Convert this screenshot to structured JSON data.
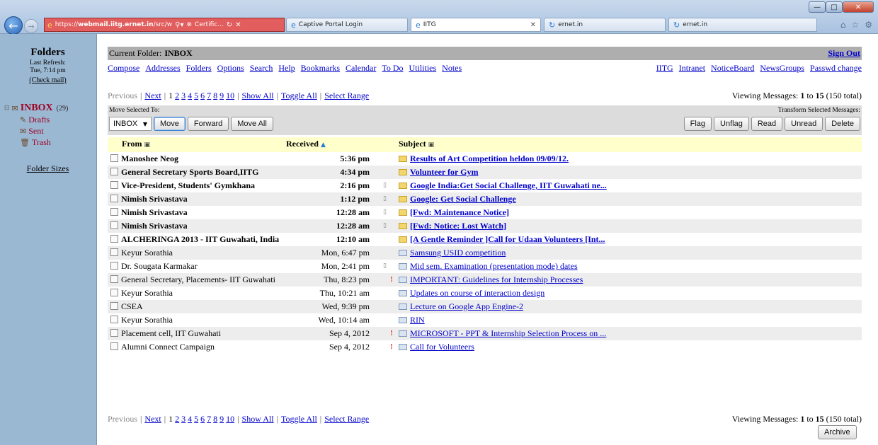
{
  "browser": {
    "address_url_prefix": "https://",
    "address_url_host": "webmail.iitg.ernet.in",
    "address_url_path": "/src/w",
    "certificate_label": "Certific...",
    "tabs": [
      {
        "label": "Captive Portal Login",
        "active": false
      },
      {
        "label": "IITG",
        "active": true
      },
      {
        "label": "ernet.in",
        "active": false
      },
      {
        "label": "ernet.in",
        "active": false
      }
    ],
    "toolbar_icons": [
      "home-icon",
      "star-icon",
      "gear-icon"
    ]
  },
  "sidebar": {
    "title": "Folders",
    "last_refresh_label": "Last Refresh:",
    "last_refresh_value": "Tue, 7:14 pm",
    "check_mail": "(Check mail)",
    "inbox_label": "INBOX",
    "inbox_count": "(29)",
    "subfolders": [
      "Drafts",
      "Sent",
      "Trash"
    ],
    "folder_sizes": "Folder Sizes"
  },
  "header": {
    "current_folder_label": "Current Folder:",
    "current_folder_value": "INBOX",
    "sign_out": "Sign Out",
    "menu_left": [
      "Compose",
      "Addresses",
      "Folders",
      "Options",
      "Search",
      "Help",
      "Bookmarks",
      "Calendar",
      "To Do",
      "Utilities",
      "Notes"
    ],
    "menu_right": [
      "IITG",
      "Intranet",
      "NoticeBoard",
      "NewsGroups",
      "Passwd change"
    ]
  },
  "pager": {
    "previous": "Previous",
    "next": "Next",
    "current_page": "1",
    "pages": [
      "2",
      "3",
      "4",
      "5",
      "6",
      "7",
      "8",
      "9",
      "10"
    ],
    "show_all": "Show All",
    "toggle_all": "Toggle All",
    "select_range": "Select Range",
    "viewing_prefix": "Viewing Messages:",
    "viewing_from": "1",
    "viewing_to_word": "to",
    "viewing_to": "15",
    "viewing_total": "(150 total)"
  },
  "actions": {
    "move_selected_label": "Move Selected To:",
    "move_target": "INBOX",
    "move_button": "Move",
    "forward_button": "Forward",
    "move_all_button": "Move All",
    "transform_label": "Transform Selected Messages:",
    "transform_buttons": [
      "Flag",
      "Unflag",
      "Read",
      "Unread",
      "Delete"
    ]
  },
  "table": {
    "col_from": "From",
    "col_received": "Received",
    "col_subject": "Subject",
    "rows": [
      {
        "from": "Manoshee Neog",
        "received": "5:36 pm",
        "subject": "Results of Art Competition heldon 09/09/12.",
        "unread": true,
        "flag": "",
        "attach": false
      },
      {
        "from": "General Secretary Sports Board,IITG",
        "received": "4:34 pm",
        "subject": "Volunteer for Gym",
        "unread": true,
        "flag": "",
        "attach": false
      },
      {
        "from": "Vice-President, Students' Gymkhana",
        "received": "2:16 pm",
        "subject": "Google India:Get Social Challenge, IIT Guwahati ne...",
        "unread": true,
        "flag": "",
        "attach": true
      },
      {
        "from": "Nimish Srivastava",
        "received": "1:12 pm",
        "subject": "Google: Get Social Challenge",
        "unread": true,
        "flag": "",
        "attach": true
      },
      {
        "from": "Nimish Srivastava",
        "received": "12:28 am",
        "subject": "[Fwd: Maintenance Notice]",
        "unread": true,
        "flag": "",
        "attach": true
      },
      {
        "from": "Nimish Srivastava",
        "received": "12:28 am",
        "subject": "[Fwd: Notice: Lost Watch]",
        "unread": true,
        "flag": "",
        "attach": true
      },
      {
        "from": "ALCHERINGA 2013 - IIT Guwahati, India",
        "received": "12:10 am",
        "subject": "[A Gentle Reminder ]Call for Udaan Volunteers [Int...",
        "unread": true,
        "flag": "",
        "attach": false
      },
      {
        "from": "Keyur Sorathia",
        "received": "Mon, 6:47 pm",
        "subject": "Samsung USID competition",
        "unread": false,
        "flag": "",
        "attach": false
      },
      {
        "from": "Dr. Sougata Karmakar",
        "received": "Mon, 2:41 pm",
        "subject": "Mid sem. Examination (presentation mode) dates",
        "unread": false,
        "flag": "",
        "attach": true
      },
      {
        "from": "General Secretary, Placements- IIT Guwahati",
        "received": "Thu, 8:23 pm",
        "subject": "IMPORTANT: Guidelines for Internship Processes",
        "unread": false,
        "flag": "!",
        "attach": false
      },
      {
        "from": "Keyur Sorathia",
        "received": "Thu, 10:21 am",
        "subject": "Updates on course of interaction design",
        "unread": false,
        "flag": "",
        "attach": false
      },
      {
        "from": "CSEA",
        "received": "Wed, 9:39 pm",
        "subject": "Lecture on Google App Engine-2",
        "unread": false,
        "flag": "",
        "attach": false
      },
      {
        "from": "Keyur Sorathia",
        "received": "Wed, 10:14 am",
        "subject": "RIN",
        "unread": false,
        "flag": "",
        "attach": false
      },
      {
        "from": "Placement cell, IIT Guwahati",
        "received": "Sep 4, 2012",
        "subject": "MICROSOFT - PPT & Internship Selection Process on ...",
        "unread": false,
        "flag": "!",
        "attach": false
      },
      {
        "from": "Alumni Connect Campaign",
        "received": "Sep 4, 2012",
        "subject": "Call for Volunteers",
        "unread": false,
        "flag": "!",
        "attach": false
      }
    ]
  },
  "archive_button": "Archive"
}
